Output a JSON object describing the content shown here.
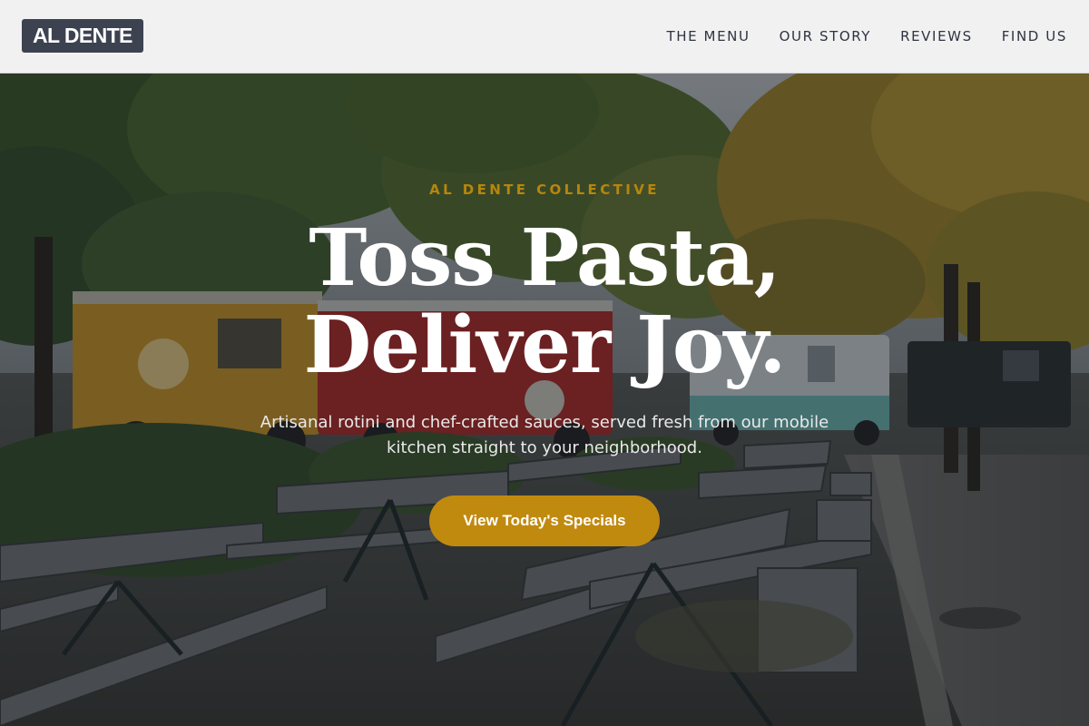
{
  "brand": {
    "logo_text": "AL DENTE"
  },
  "nav": {
    "items": [
      {
        "label": "THE MENU"
      },
      {
        "label": "OUR STORY"
      },
      {
        "label": "REVIEWS"
      },
      {
        "label": "FIND US"
      }
    ]
  },
  "hero": {
    "kicker": "AL DENTE COLLECTIVE",
    "headline_line1": "Toss Pasta,",
    "headline_line2": "Deliver Joy.",
    "subtitle": "Artisanal rotini and chef-crafted sauces, served fresh from our mobile kitchen straight to your neighborhood.",
    "cta_label": "View Today's Specials"
  },
  "colors": {
    "header_bg": "#f1f1f1",
    "logo_bg": "#3c4250",
    "nav_text": "#2e3440",
    "accent_gold": "#c08a0f",
    "kicker_gold": "#b8860b",
    "headline": "#ffffff"
  }
}
